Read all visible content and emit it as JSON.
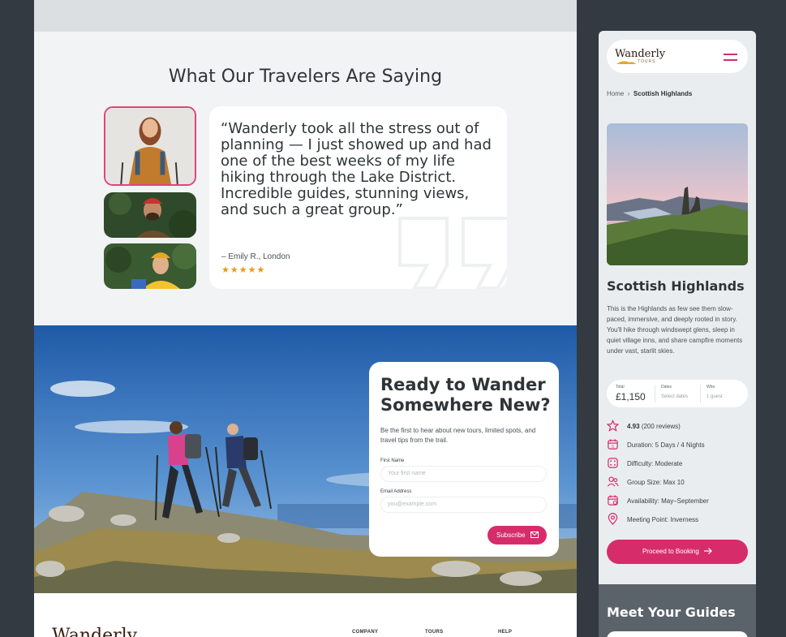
{
  "testimonials": {
    "title": "What Our Travelers Are Saying",
    "quote": "“Wanderly took all the stress out of planning — I just showed up and had one of the best weeks of my life hiking through the Lake District. Incredible guides, stunning views, and such a great group.”",
    "author": "– Emily R., London",
    "rating_stars": "★★★★★",
    "rating": 5
  },
  "newsletter": {
    "title": "Ready to Wander Somewhere New?",
    "description": "Be the first to hear about new tours, limited spots, and travel tips from the trail.",
    "first_name_label": "First Name",
    "first_name_placeholder": "Your first name",
    "email_label": "Email Address",
    "email_placeholder": "you@example.com",
    "subscribe_label": "Subscribe"
  },
  "footer": {
    "logo": "Wanderly",
    "columns": [
      "COMPANY",
      "TOURS",
      "HELP"
    ]
  },
  "mobile": {
    "logo": "Wanderly",
    "logo_sub": "TOURS",
    "breadcrumb": {
      "home": "Home",
      "separator": "›",
      "current": "Scottish Highlands"
    },
    "tour_title": "Scottish Highlands",
    "tour_description": "This is the Highlands as few see them slow-paced, immersive, and deeply rooted in story. You'll hike through windswept glens, sleep in quiet village inns, and share campfire moments under vast, starlit skies.",
    "booking": {
      "total_label": "Total",
      "total_value": "£1,150",
      "dates_label": "Dates",
      "dates_value": "Select dates",
      "who_label": "Who",
      "who_value": "1 guest"
    },
    "facts": {
      "rating_value": "4.93",
      "rating_reviews": "(200 reviews)",
      "duration": "Duration: 5 Days / 4 Nights",
      "difficulty": "Difficulty: Moderate",
      "group_size": "Group Size: Max 10",
      "availability": "Availability: May–September",
      "meeting_point": "Meeting Point: Inverness"
    },
    "cta": "Proceed to Booking",
    "guides_title": "Meet Your Guides"
  },
  "colors": {
    "accent": "#d62d6a",
    "star": "#e89a16",
    "page_bg": "#333a41",
    "section_bg": "#f1f3f4"
  },
  "icons": [
    "star-icon",
    "calendar-icon",
    "dice-icon",
    "users-icon",
    "calendar-check-icon",
    "map-pin-icon",
    "mail-icon",
    "arrow-right-icon",
    "hamburger-icon",
    "quote-icon"
  ]
}
